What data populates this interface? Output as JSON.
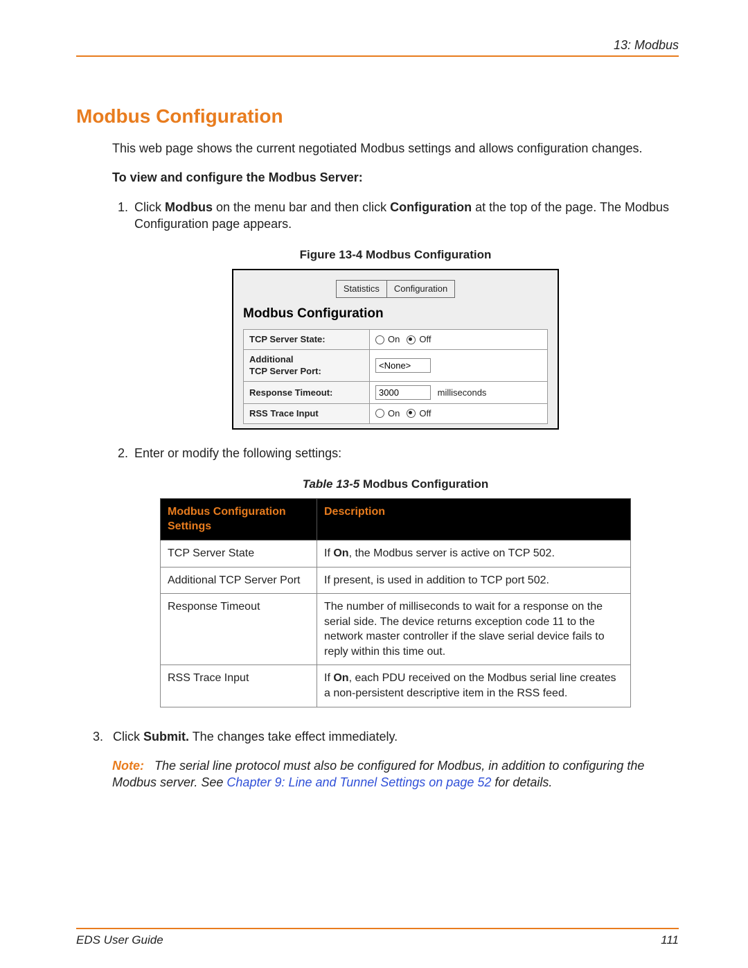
{
  "header": {
    "chapter": "13: Modbus"
  },
  "title": "Modbus Configuration",
  "intro": "This web page shows the current negotiated Modbus settings and allows configuration changes.",
  "subhead": "To view and configure the Modbus Server:",
  "step1_pre": "Click ",
  "step1_b1": "Modbus",
  "step1_mid": " on the menu bar and then click ",
  "step1_b2": "Configuration",
  "step1_post": " at the top of the page. The Modbus Configuration page appears.",
  "figure_caption": "Figure 13-4  Modbus Configuration",
  "embedded": {
    "tabs": {
      "statistics": "Statistics",
      "configuration": "Configuration"
    },
    "title": "Modbus Configuration",
    "rows": {
      "tcp_state_label": "TCP Server State:",
      "tcp_state_on": "On",
      "tcp_state_off": "Off",
      "tcp_state_value": "off",
      "addl_port_label": "Additional\nTCP Server Port:",
      "addl_port_value": "<None>",
      "resp_timeout_label": "Response Timeout:",
      "resp_timeout_value": "3000",
      "resp_timeout_unit": "milliseconds",
      "rss_label": "RSS Trace Input",
      "rss_on": "On",
      "rss_off": "Off",
      "rss_value": "off"
    }
  },
  "step2": "Enter or modify the following settings:",
  "table_caption_italic": "Table 13-5",
  "table_caption_rest": "  Modbus Configuration",
  "table": {
    "headers": {
      "c1": "Modbus Configuration Settings",
      "c2": "Description"
    },
    "rows": [
      {
        "name": "TCP Server State",
        "desc_pre": "If ",
        "desc_b": "On",
        "desc_post": ", the Modbus server is active on TCP 502."
      },
      {
        "name": "Additional TCP Server Port",
        "desc_pre": "If present, is used in addition to TCP port 502.",
        "desc_b": "",
        "desc_post": ""
      },
      {
        "name": "Response Timeout",
        "desc_pre": "The number of milliseconds to wait for a response on the serial side.  The device returns exception code 11 to the network master controller if the slave serial device fails to reply within this time out.",
        "desc_b": "",
        "desc_post": ""
      },
      {
        "name": "RSS Trace Input",
        "desc_pre": "If ",
        "desc_b": "On",
        "desc_post": ", each PDU received on the Modbus serial line creates a non-persistent descriptive item in the RSS feed."
      }
    ]
  },
  "step3_pre": "Click ",
  "step3_b": "Submit.",
  "step3_post": " The changes take effect immediately.",
  "note": {
    "label": "Note:",
    "part1": "The serial line protocol must also be configured for Modbus, in addition to configuring the Modbus server. See ",
    "link": "Chapter 9: Line and Tunnel Settings on page 52",
    "part2": " for details."
  },
  "footer": {
    "left": "EDS User Guide",
    "right": "111"
  }
}
